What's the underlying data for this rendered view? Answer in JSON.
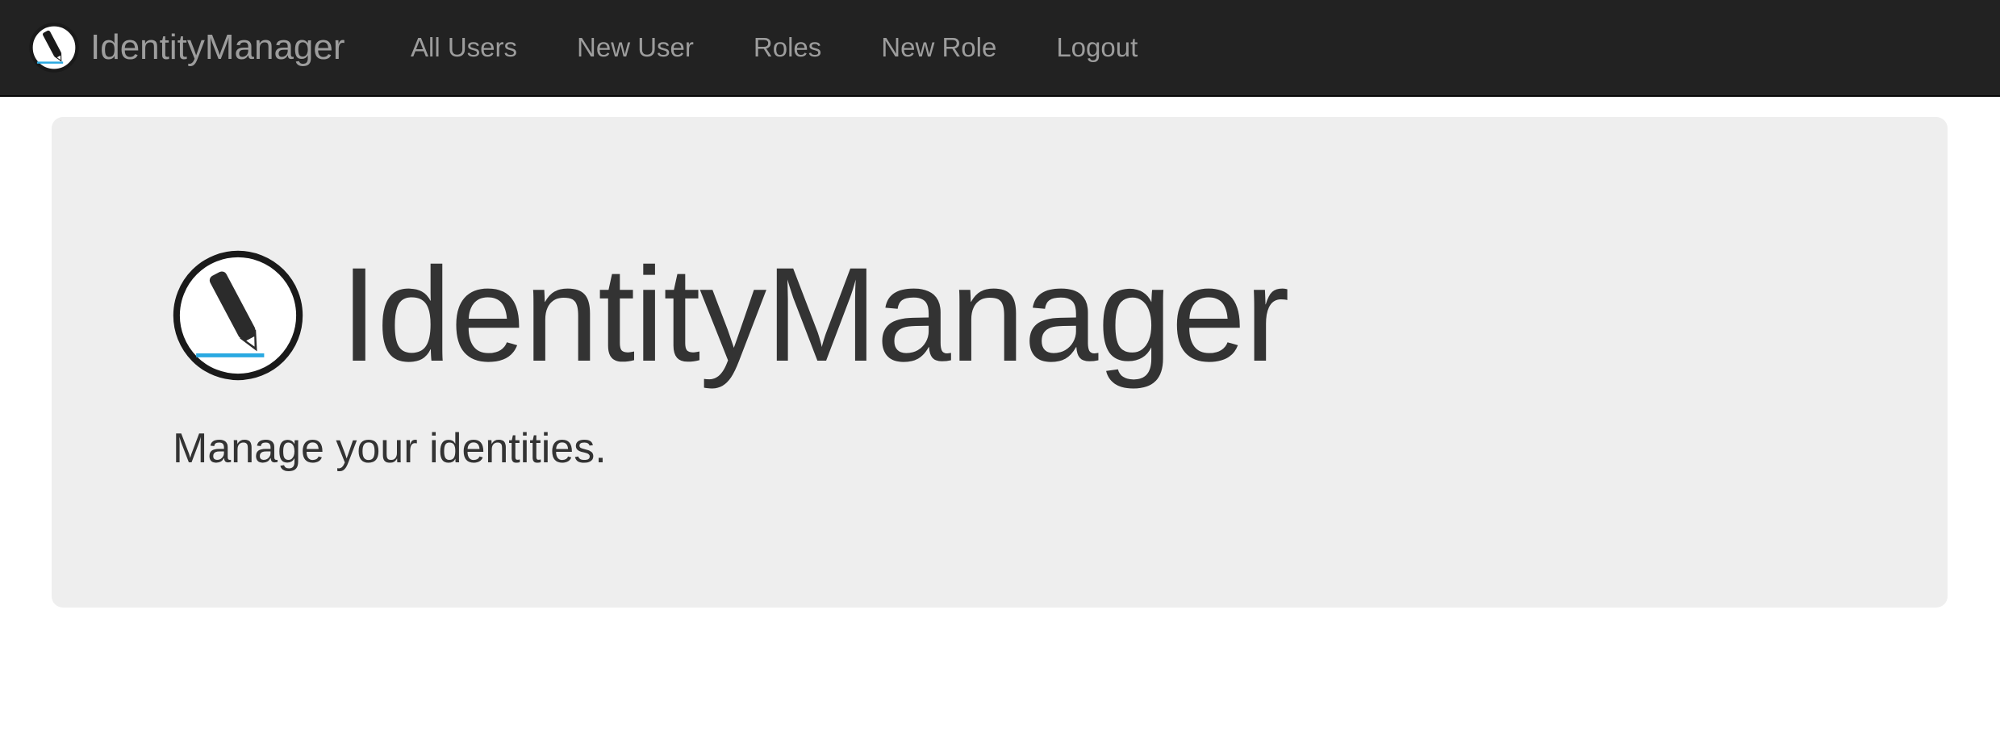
{
  "app": {
    "brand_name": "IdentityManager",
    "logo_icon": "pen-circle-icon"
  },
  "nav": {
    "items": [
      {
        "label": "All Users"
      },
      {
        "label": "New User"
      },
      {
        "label": "Roles"
      },
      {
        "label": "New Role"
      },
      {
        "label": "Logout"
      }
    ]
  },
  "hero": {
    "title": "IdentityManager",
    "tagline": "Manage your identities."
  },
  "colors": {
    "navbar_bg": "#222222",
    "nav_text": "#9d9d9d",
    "jumbotron_bg": "#eeeeee",
    "text": "#333333",
    "logo_accent": "#29a9e1"
  }
}
